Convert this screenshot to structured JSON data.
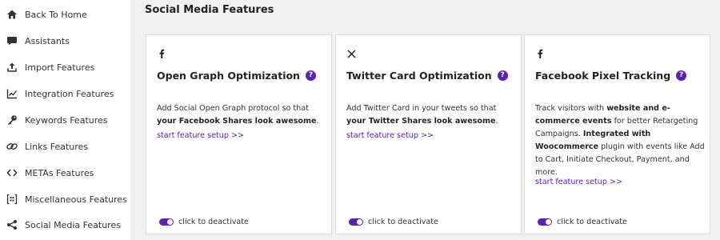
{
  "sidebar": {
    "items": [
      {
        "label": "Back To Home",
        "icon": "home-icon"
      },
      {
        "label": "Assistants",
        "icon": "chat-bubble-icon"
      },
      {
        "label": "Import Features",
        "icon": "upload-icon"
      },
      {
        "label": "Integration Features",
        "icon": "line-chart-icon"
      },
      {
        "label": "Keywords Features",
        "icon": "key-icon"
      },
      {
        "label": "Links Features",
        "icon": "link-icon"
      },
      {
        "label": "METAs Features",
        "icon": "code-icon"
      },
      {
        "label": "Miscellaneous Features",
        "icon": "brackets-grid-icon"
      },
      {
        "label": "Social Media Features",
        "icon": "share-icon"
      }
    ]
  },
  "main": {
    "title": "Social Media Features",
    "cards": [
      {
        "icon": "facebook-icon",
        "title": "Open Graph Optimization",
        "help": "?",
        "desc": [
          {
            "text": "Add Social Open Graph protocol so that "
          },
          {
            "text": "your Facebook Shares look awesome",
            "bold": true
          },
          {
            "text": "."
          }
        ],
        "link": "start feature setup >>",
        "toggle_label": "click to deactivate",
        "toggle_on": true
      },
      {
        "icon": "x-twitter-icon",
        "title": "Twitter Card Optimization",
        "help": "?",
        "desc": [
          {
            "text": "Add Twitter Card in your tweets so that "
          },
          {
            "text": "your Twitter Shares look awesome",
            "bold": true
          },
          {
            "text": "."
          }
        ],
        "link": "start feature setup >>",
        "toggle_label": "click to deactivate",
        "toggle_on": true
      },
      {
        "icon": "facebook-icon",
        "title": "Facebook Pixel Tracking",
        "help": "?",
        "desc": [
          {
            "text": "Track visitors with "
          },
          {
            "text": "website and e-commerce events",
            "bold": true
          },
          {
            "text": " for better Retargeting Campaigns. "
          },
          {
            "text": "Integrated with Woocommerce",
            "bold": true
          },
          {
            "text": " plugin with events like Add to Cart, Initiate Checkout, Payment, and more."
          }
        ],
        "link": "start feature setup >>",
        "toggle_label": "click to deactivate",
        "toggle_on": true
      }
    ]
  },
  "colors": {
    "accent": "#5b21b6",
    "background": "#f0f0f1",
    "card": "#ffffff"
  }
}
